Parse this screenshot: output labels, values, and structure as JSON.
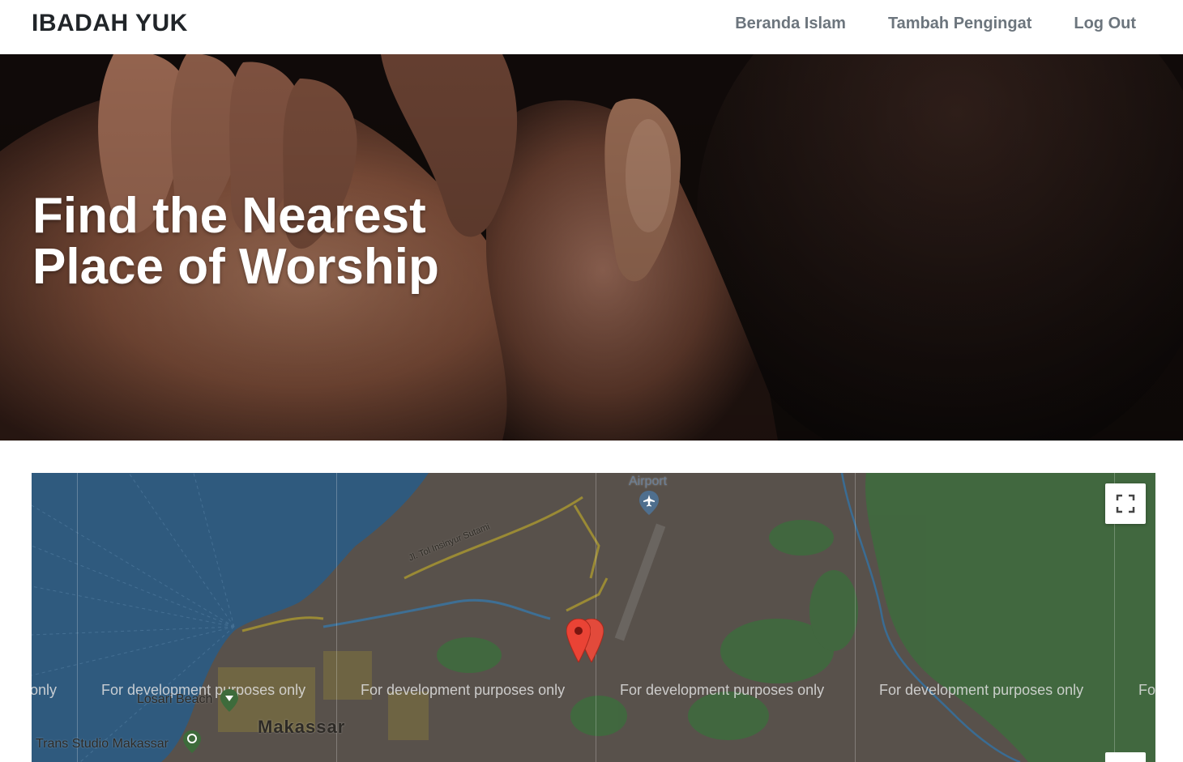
{
  "navbar": {
    "brand": "IBADAH YUK",
    "links": [
      "Beranda Islam",
      "Tambah Pengingat",
      "Log Out"
    ]
  },
  "hero": {
    "title_line1": "Find the Nearest",
    "title_line2": "Place of Worship"
  },
  "map": {
    "watermark": "For development purposes only",
    "watermark_partial_left": "only",
    "watermark_partial_right": "Fo",
    "labels": {
      "airport": "Airport",
      "road": "Jl. Tol Insinyur Sutami",
      "beach": "Losari Beach",
      "city": "Makassar",
      "theme_park": "Trans Studio Makassar"
    },
    "icons": [
      "airport-icon",
      "beach-pin-icon",
      "theme-park-icon",
      "fullscreen-icon",
      "map-marker-icon"
    ],
    "colors": {
      "water": "#2f5a7e",
      "land": "#58514b",
      "forest": "#3f6a3e",
      "road": "#9a8a35",
      "marker": "#ea4335"
    }
  }
}
